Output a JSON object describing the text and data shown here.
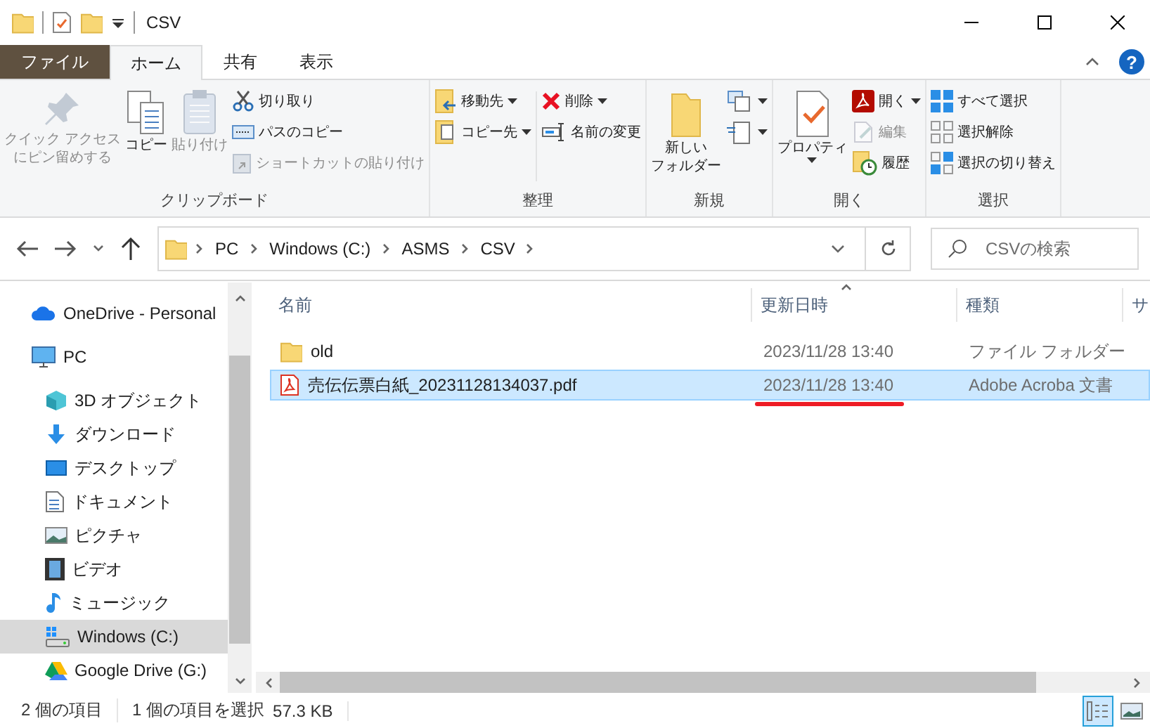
{
  "window": {
    "title": "CSV"
  },
  "tabs": [
    {
      "label": "ファイル",
      "kind": "file",
      "selected": false
    },
    {
      "label": "ホーム",
      "kind": "tab",
      "selected": true
    },
    {
      "label": "共有",
      "kind": "tab",
      "selected": false
    },
    {
      "label": "表示",
      "kind": "tab",
      "selected": false
    }
  ],
  "help": "?",
  "ribbon": {
    "groups": [
      {
        "label": "クリップボード",
        "columns": [
          {
            "kind": "large",
            "items": [
              {
                "lines": [
                  "クイック アクセス",
                  "にピン留めする"
                ],
                "disabled": true,
                "dropdown": false
              }
            ]
          },
          {
            "kind": "large",
            "items": [
              {
                "lines": [
                  "コピー"
                ],
                "disabled": false,
                "dropdown": false
              }
            ]
          },
          {
            "kind": "large",
            "items": [
              {
                "lines": [
                  "貼り付け"
                ],
                "disabled": true,
                "dropdown": false
              }
            ]
          },
          {
            "kind": "stack",
            "items": [
              {
                "label": "切り取り",
                "disabled": false,
                "dropdown": false
              },
              {
                "label": "パスのコピー",
                "disabled": false,
                "dropdown": false
              },
              {
                "label": "ショートカットの貼り付け",
                "disabled": true,
                "dropdown": false
              }
            ]
          }
        ]
      },
      {
        "label": "整理",
        "columns": [
          {
            "kind": "stack",
            "items": [
              {
                "label": "移動先",
                "disabled": false,
                "dropdown": true
              },
              {
                "label": "コピー先",
                "disabled": false,
                "dropdown": true
              }
            ]
          },
          {
            "kind": "stack",
            "items": [
              {
                "label": "削除",
                "disabled": false,
                "dropdown": true
              },
              {
                "label": "名前の変更",
                "disabled": false,
                "dropdown": false
              }
            ]
          }
        ]
      },
      {
        "label": "新規",
        "columns": [
          {
            "kind": "large",
            "items": [
              {
                "lines": [
                  "新しい",
                  "フォルダー"
                ],
                "disabled": false,
                "dropdown": false
              }
            ]
          },
          {
            "kind": "stack",
            "items": [
              {
                "disabled": false,
                "dropdown": true
              },
              {
                "disabled": false,
                "dropdown": true
              }
            ]
          }
        ]
      },
      {
        "label": "開く",
        "columns": [
          {
            "kind": "large",
            "items": [
              {
                "lines": [
                  "プロパティ"
                ],
                "disabled": false,
                "dropdown": true
              }
            ]
          },
          {
            "kind": "stack",
            "items": [
              {
                "label": "開く",
                "disabled": false,
                "dropdown": true
              },
              {
                "label": "編集",
                "disabled": true,
                "dropdown": false
              },
              {
                "label": "履歴",
                "disabled": false,
                "dropdown": false
              }
            ]
          }
        ]
      },
      {
        "label": "選択",
        "columns": [
          {
            "kind": "stack",
            "items": [
              {
                "label": "すべて選択",
                "disabled": false,
                "dropdown": false
              },
              {
                "label": "選択解除",
                "disabled": false,
                "dropdown": false
              },
              {
                "label": "選択の切り替え",
                "disabled": false,
                "dropdown": false
              }
            ]
          }
        ]
      }
    ]
  },
  "address": {
    "segments": [
      "PC",
      "Windows (C:)",
      "ASMS",
      "CSV"
    ]
  },
  "search": {
    "placeholder": "CSVの検索"
  },
  "sidebar": {
    "items": [
      {
        "label": "OneDrive - Personal",
        "selected": false
      },
      {
        "label": "PC",
        "selected": false,
        "children": [
          {
            "label": "3D オブジェクト",
            "selected": false
          },
          {
            "label": "ダウンロード",
            "selected": false
          },
          {
            "label": "デスクトップ",
            "selected": false
          },
          {
            "label": "ドキュメント",
            "selected": false
          },
          {
            "label": "ピクチャ",
            "selected": false
          },
          {
            "label": "ビデオ",
            "selected": false
          },
          {
            "label": "ミュージック",
            "selected": false
          },
          {
            "label": "Windows (C:)",
            "selected": true
          },
          {
            "label": "Google Drive (G:)",
            "selected": false
          }
        ]
      }
    ]
  },
  "table": {
    "columns": [
      "名前",
      "更新日時",
      "種類",
      "サ"
    ],
    "rows": [
      {
        "kind": "folder",
        "name": "old",
        "modified": "2023/11/28 13:40",
        "type": "ファイル フォルダー",
        "selected": false,
        "underlined": false
      },
      {
        "kind": "pdf",
        "name": "売伝伝票白紙_20231128134037.pdf",
        "modified": "2023/11/28 13:40",
        "type": "Adobe Acroba 文書",
        "selected": true,
        "underlined": true
      }
    ]
  },
  "status_bar": {
    "count": "2 個の項目",
    "selection": "1 個の項目を選択",
    "size": "57.3 KB",
    "views": [
      {
        "kind": "details",
        "selected": true
      },
      {
        "kind": "large",
        "selected": false
      }
    ]
  }
}
